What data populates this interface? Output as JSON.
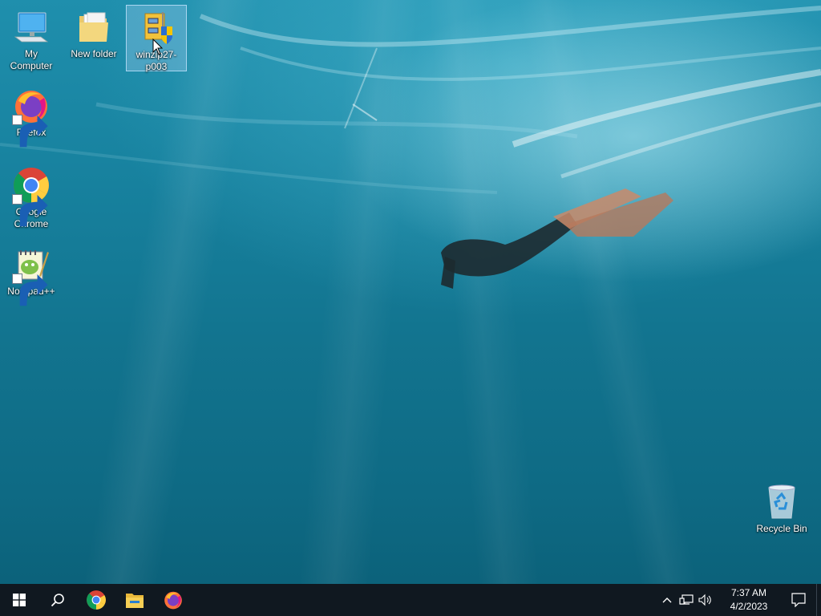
{
  "desktop": {
    "icons": [
      {
        "label": "My Computer",
        "icon": "computer-icon"
      },
      {
        "label": "New folder",
        "icon": "folder-icon"
      },
      {
        "label": "winzip27-p003",
        "icon": "winzip-installer-icon"
      },
      {
        "label": "Firefox",
        "icon": "firefox-icon"
      },
      {
        "label": "Google Chrome",
        "icon": "chrome-icon"
      },
      {
        "label": "Notepad++",
        "icon": "notepadpp-icon"
      },
      {
        "label": "Recycle Bin",
        "icon": "recycle-bin-icon"
      }
    ]
  },
  "taskbar": {
    "start_icon": "windows-logo-icon",
    "search_icon": "search-icon",
    "pinned": [
      "chrome-icon",
      "file-explorer-icon",
      "firefox-icon"
    ],
    "tray": {
      "chevron_icon": "chevron-up-icon",
      "network_icon": "network-icon",
      "volume_icon": "volume-icon",
      "time": "7:37 AM",
      "date": "4/2/2023",
      "notification_icon": "action-center-icon"
    }
  },
  "colors": {
    "taskbar": "#101820",
    "selection": "#a0cdf0"
  }
}
